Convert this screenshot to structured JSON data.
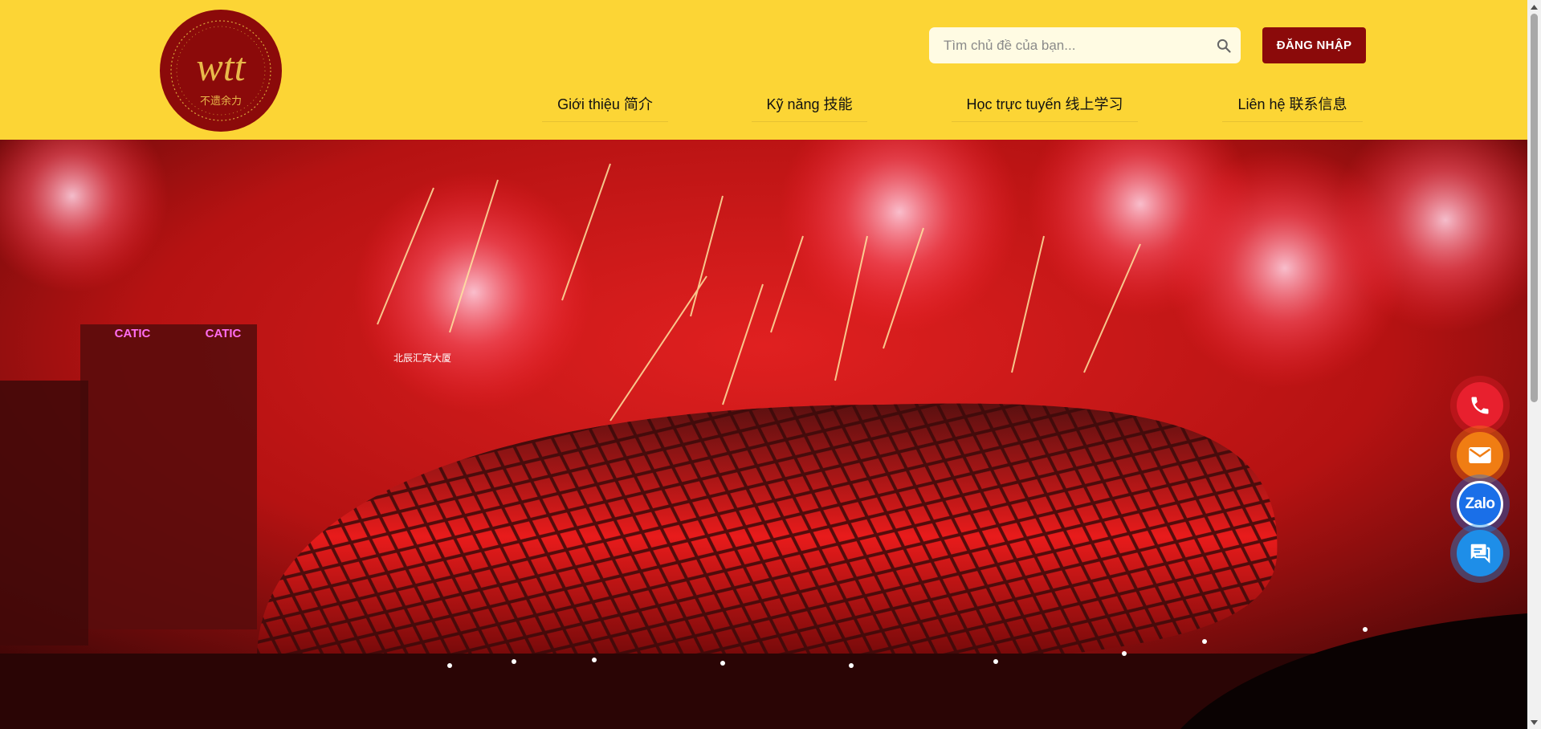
{
  "logo": {
    "main_text": "wtt",
    "sub_text": "不遗余力"
  },
  "search": {
    "placeholder": "Tìm chủ đề của bạn...",
    "value": "",
    "icon": "search-icon"
  },
  "login_button": {
    "label": "ĐĂNG NHẬP"
  },
  "nav": [
    {
      "label": "Giới thiệu 简介"
    },
    {
      "label": "Kỹ năng 技能"
    },
    {
      "label": "Học trực tuyến 线上学习"
    },
    {
      "label": "Liên hệ 联系信息"
    }
  ],
  "hero": {
    "signs": [
      "CATIC",
      "CATIC",
      "北辰汇宾大厦"
    ]
  },
  "contact_buttons": [
    {
      "icon": "phone-icon",
      "color": "#e8202e"
    },
    {
      "icon": "mail-icon",
      "color": "#f07d13"
    },
    {
      "icon": "zalo-icon",
      "label": "Zalo",
      "color": "#1a6fe8"
    },
    {
      "icon": "chat-icon",
      "color": "#1e8ee8"
    }
  ],
  "colors": {
    "header_bg": "#fcd535",
    "brand_red": "#8b0a0a"
  }
}
